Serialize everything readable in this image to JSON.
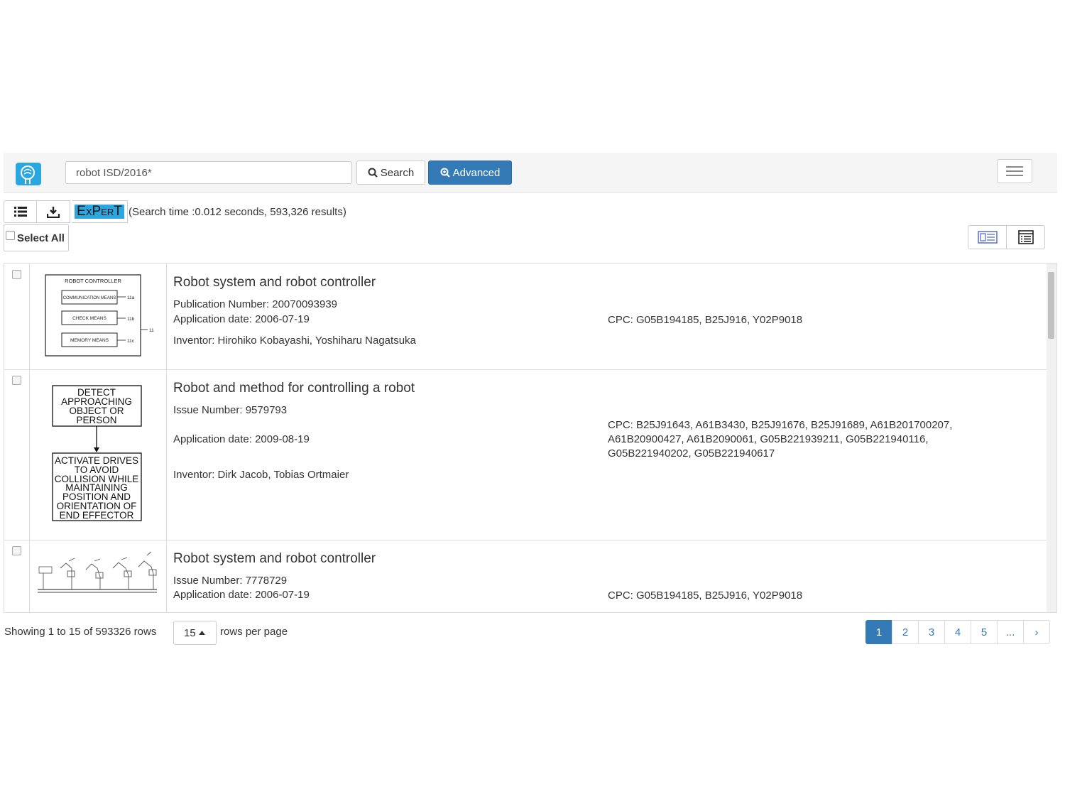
{
  "search": {
    "query": "robot ISD/2016*",
    "search_label": "Search",
    "advanced_label": "Advanced"
  },
  "toolbar": {
    "expert_label": "ExPerT",
    "search_info": "(Search time :0.012 seconds, 593,326 results)",
    "select_all_label": "Select All"
  },
  "results": [
    {
      "title": "Robot system and robot controller",
      "number_label": "Publication Number: 20070093939",
      "application_date": "Application date: 2006-07-19",
      "cpc": "CPC: G05B194185, B25J916, Y02P9018",
      "inventor": "Inventor: Hirohiko Kobayashi, Yoshiharu Nagatsuka",
      "figure": {
        "heading": "ROBOT CONTROLLER",
        "box1": "COMMUNICATION MEANS",
        "box2": "CHECK MEANS",
        "box3": "MEMORY MEANS",
        "ref1": "11a",
        "ref2": "11b",
        "ref3": "11c",
        "ref_outer": "11"
      }
    },
    {
      "title": "Robot and method for controlling a robot",
      "number_label": "Issue Number: 9579793",
      "application_date": "Application date: 2009-08-19",
      "cpc": "CPC: B25J91643, A61B3430, B25J91676, B25J91689, A61B201700207, A61B20900427, A61B2090061, G05B221939211, G05B221940116, G05B221940202, G05B221940617",
      "inventor": "Inventor: Dirk Jacob, Tobias Ortmaier",
      "figure": {
        "box1_lines": [
          "DETECT",
          "APPROACHING",
          "OBJECT OR",
          "PERSON"
        ],
        "box2_lines": [
          "ACTIVATE DRIVES",
          "TO AVOID",
          "COLLISION WHILE",
          "MAINTAINING",
          "POSITION AND",
          "ORIENTATION OF",
          "END EFFECTOR"
        ]
      }
    },
    {
      "title": "Robot system and robot controller",
      "number_label": "Issue Number: 7778729",
      "application_date": "Application date: 2006-07-19",
      "cpc": "CPC: G05B194185, B25J916, Y02P9018"
    }
  ],
  "footer": {
    "showing": "Showing 1 to 15 of 593326 rows",
    "rows_value": "15",
    "rows_per_page": "rows per page",
    "pages": [
      "1",
      "2",
      "3",
      "4",
      "5",
      "...",
      "›"
    ]
  },
  "colors": {
    "primary": "#337ab7",
    "logo": "#2aa6e0"
  }
}
